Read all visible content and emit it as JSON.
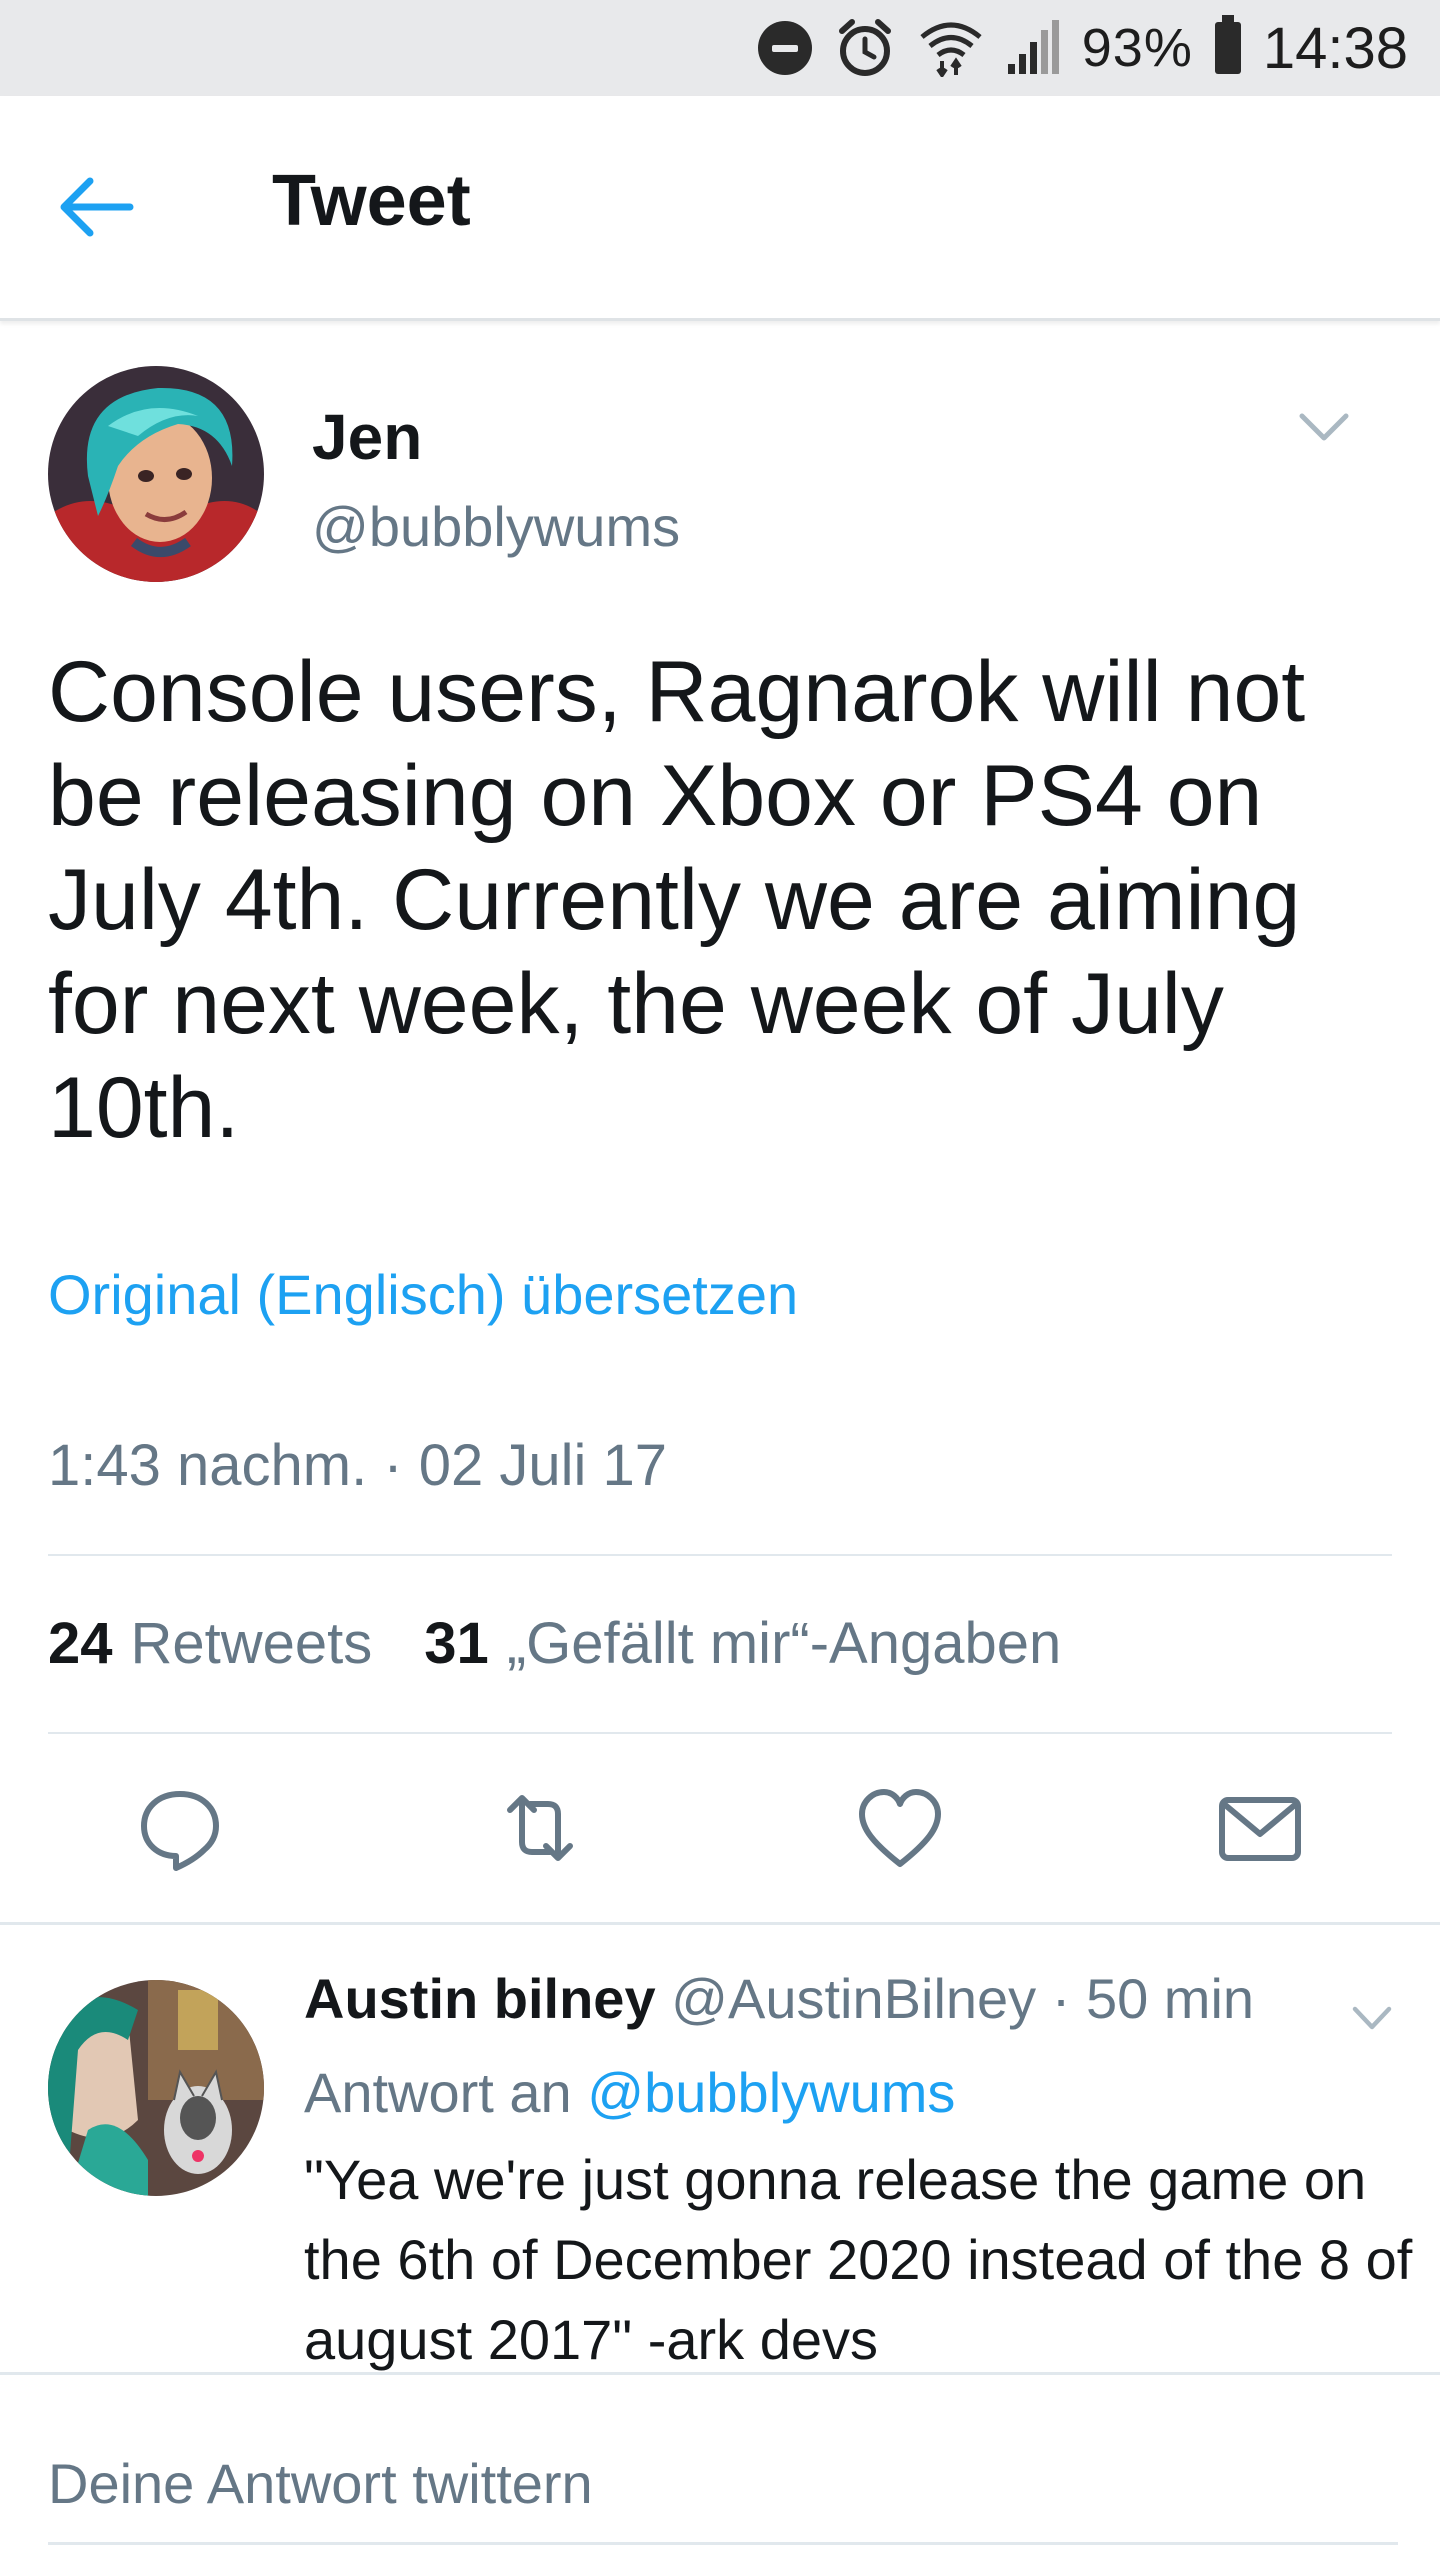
{
  "status_bar": {
    "battery": "93%",
    "time": "14:38",
    "icons": [
      "do-not-disturb-icon",
      "alarm-icon",
      "wifi-icon",
      "signal-icon",
      "battery-icon"
    ]
  },
  "header": {
    "title": "Tweet",
    "back_icon": "back-arrow-icon"
  },
  "tweet": {
    "author_name": "Jen",
    "author_handle": "@bubblywums",
    "text": "Console users, Ragnarok will not be releasing on Xbox or PS4 on July 4th. Currently we are aiming for next week, the week of July 10th.",
    "translate_label": "Original (Englisch) übersetzen",
    "timestamp": "1:43 nachm. · 02 Juli 17",
    "stats": {
      "retweets_count": "24",
      "retweets_label": "Retweets",
      "likes_count": "31",
      "likes_label": "„Gefällt mir“-Angaben"
    },
    "actions": [
      "reply-icon",
      "retweet-icon",
      "like-icon",
      "direct-message-icon"
    ]
  },
  "reply": {
    "author_name": "Austin bilney",
    "author_handle": "@AustinBilney",
    "time": "· 50 min",
    "reply_to_label": "Antwort an",
    "reply_to_handle": "@bubblywums",
    "text": "\"Yea we're just gonna release the game on the 6th of December 2020 instead of the 8 of august 2017\" -ark devs"
  },
  "compose": {
    "placeholder": "Deine Antwort twittern"
  },
  "colors": {
    "accent": "#1da1f2",
    "secondary_text": "#657786",
    "primary_text": "#14171a",
    "divider": "#e1e8ed"
  }
}
